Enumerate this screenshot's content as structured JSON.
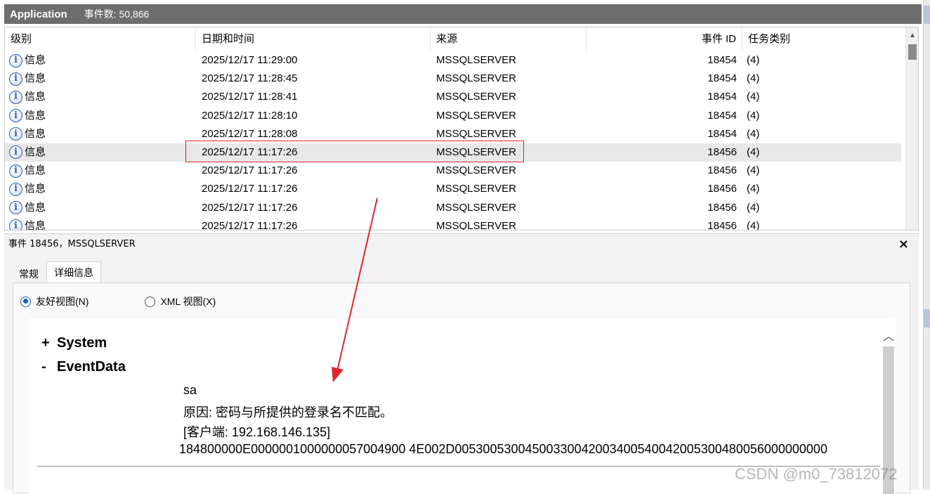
{
  "titlebar": {
    "app": "Application",
    "count": "事件数: 50,866"
  },
  "table": {
    "columns": {
      "level": "级别",
      "date": "日期和时间",
      "source": "来源",
      "event_id": "事件 ID",
      "task": "任务类别"
    },
    "rows": [
      {
        "level": "信息",
        "date": "2025/12/17 11:29:00",
        "source": "MSSQLSERVER",
        "event_id": "18454",
        "task": "(4)"
      },
      {
        "level": "信息",
        "date": "2025/12/17 11:28:45",
        "source": "MSSQLSERVER",
        "event_id": "18454",
        "task": "(4)"
      },
      {
        "level": "信息",
        "date": "2025/12/17 11:28:41",
        "source": "MSSQLSERVER",
        "event_id": "18454",
        "task": "(4)"
      },
      {
        "level": "信息",
        "date": "2025/12/17 11:28:10",
        "source": "MSSQLSERVER",
        "event_id": "18454",
        "task": "(4)"
      },
      {
        "level": "信息",
        "date": "2025/12/17 11:28:08",
        "source": "MSSQLSERVER",
        "event_id": "18454",
        "task": "(4)"
      },
      {
        "level": "信息",
        "date": "2025/12/17 11:17:26",
        "source": "MSSQLSERVER",
        "event_id": "18456",
        "task": "(4)"
      },
      {
        "level": "信息",
        "date": "2025/12/17 11:17:26",
        "source": "MSSQLSERVER",
        "event_id": "18456",
        "task": "(4)"
      },
      {
        "level": "信息",
        "date": "2025/12/17 11:17:26",
        "source": "MSSQLSERVER",
        "event_id": "18456",
        "task": "(4)"
      },
      {
        "level": "信息",
        "date": "2025/12/17 11:17:26",
        "source": "MSSQLSERVER",
        "event_id": "18456",
        "task": "(4)"
      },
      {
        "level": "信息",
        "date": "2025/12/17 11:17:26",
        "source": "MSSQLSERVER",
        "event_id": "18456",
        "task": "(4)"
      }
    ],
    "selected_row": 5
  },
  "detail": {
    "header": "事件 18456，MSSQLSERVER",
    "close": "×",
    "tabs": [
      "常规",
      "详细信息"
    ],
    "radio_friendly": "友好视图(N)",
    "radio_xml": "XML 视图(X)",
    "system_sign": "+",
    "system": "System",
    "eventdata_sign": "-",
    "eventdata": "EventData",
    "lines": [
      "sa",
      "原因: 密码与所提供的登录名不匹配。",
      "[客户端: 192.168.146.135]",
      "184800000E0000001000000057004900 4E002D00530053004500330042003400540042005300480056000000000"
    ]
  },
  "icons": {
    "info": "info-circle-icon",
    "close": "close-icon",
    "scroll_up": "chevron-up-icon"
  },
  "colors": {
    "titlebar": "#6d6d6d",
    "highlight": "#d9262c",
    "radio_accent": "#1a5fb4"
  },
  "watermark": "CSDN @m0_73812072"
}
